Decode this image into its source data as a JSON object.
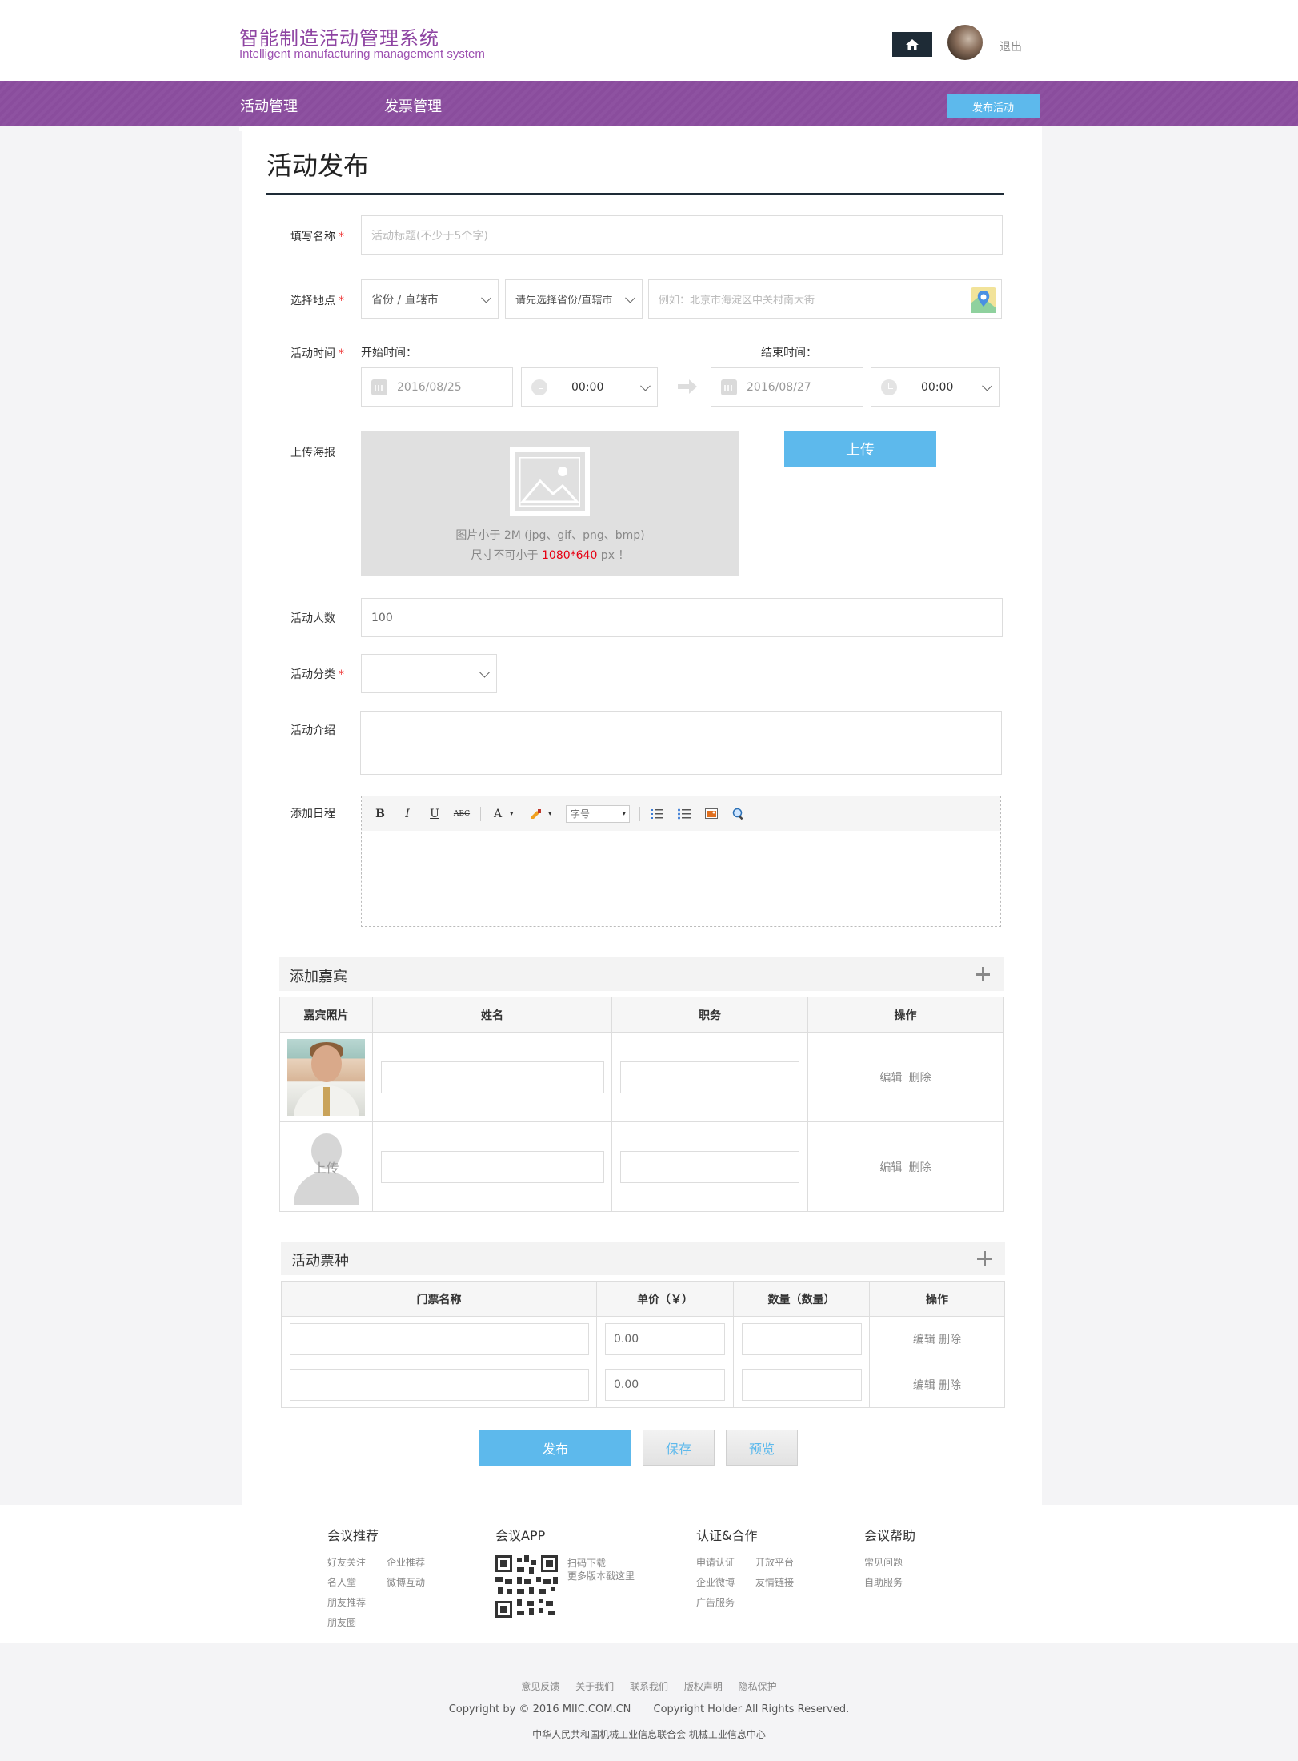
{
  "header": {
    "title_cn": "智能制造活动管理系统",
    "title_en": "Intelligent manufacturing management system",
    "logout": "退出"
  },
  "nav": {
    "items": [
      {
        "label": "活动管理",
        "active": true
      },
      {
        "label": "发票管理",
        "active": false
      }
    ],
    "publish_button": "发布活动"
  },
  "page": {
    "title": "活动发布"
  },
  "form": {
    "name": {
      "label": "填写名称",
      "required": true,
      "placeholder": "活动标题(不少于5个字)"
    },
    "location": {
      "label": "选择地点",
      "required": true,
      "province": "省份 / 直辖市",
      "city": "请先选择省份/直辖市",
      "address_placeholder": "例如：北京市海淀区中关村南大街",
      "map_icon": "map-pin-icon"
    },
    "time": {
      "label": "活动时间",
      "required": true,
      "start_label": "开始时间：",
      "end_label": "结束时间：",
      "start_date": "2016/08/25",
      "start_time": "00:00",
      "end_date": "2016/08/27",
      "end_time": "00:00"
    },
    "poster": {
      "label": "上传海报",
      "hint1": "图片小于 2M (jpg、gif、png、bmp)",
      "hint2_prefix": "尺寸不可小于 ",
      "hint2_size": "1080*640",
      "hint2_suffix": " px ！",
      "upload_button": "上传"
    },
    "count": {
      "label": "活动人数",
      "value": "100"
    },
    "category": {
      "label": "活动分类",
      "required": true,
      "value": ""
    },
    "intro": {
      "label": "活动介绍",
      "value": ""
    },
    "schedule": {
      "label": "添加日程",
      "toolbar": {
        "bold": "B",
        "italic": "I",
        "underline": "U",
        "strike": "ABC",
        "font_color": "A",
        "font_size": "字号"
      }
    }
  },
  "guests": {
    "title": "添加嘉宾",
    "headers": [
      "嘉宾照片",
      "姓名",
      "职务",
      "操作"
    ],
    "rows": [
      {
        "photo": "guest-photo",
        "name": "",
        "position": ""
      },
      {
        "photo": "placeholder",
        "upload_label": "上传",
        "name": "",
        "position": ""
      }
    ],
    "edit": "编辑",
    "delete": "删除"
  },
  "tickets": {
    "title": "活动票种",
    "headers": [
      "门票名称",
      "单价（￥）",
      "数量（数量）",
      "操作"
    ],
    "rows": [
      {
        "name": "",
        "price": "0.00",
        "qty": ""
      },
      {
        "name": "",
        "price": "0.00",
        "qty": ""
      }
    ],
    "edit": "编辑",
    "delete": "删除"
  },
  "actions": {
    "publish": "发布",
    "save": "保存",
    "preview": "预览"
  },
  "footer": {
    "columns": [
      {
        "title": "会议推荐",
        "links": [
          "好友关注",
          "企业推荐",
          "名人堂",
          "微博互动",
          "朋友推荐",
          "",
          "朋友圈",
          ""
        ]
      },
      {
        "title": "会议APP",
        "qr_text_1": "扫码下载",
        "qr_text_2": "更多版本戳这里"
      },
      {
        "title": "认证&合作",
        "links": [
          "申请认证",
          "开放平台",
          "企业微博",
          "友情链接",
          "广告服务",
          ""
        ]
      },
      {
        "title": "会议帮助",
        "links": [
          "常见问题",
          "",
          "自助服务",
          ""
        ]
      }
    ],
    "bottom_links": [
      "意见反馈",
      "关于我们",
      "联系我们",
      "版权声明",
      "隐私保护"
    ],
    "copyright_1": "Copyright by © 2016 MIIC.COM.CN",
    "copyright_2": "Copyright Holder All Rights Reserved.",
    "org": "-  中华人民共和国机械工业信息联合会   机械工业信息中心  -"
  },
  "colors": {
    "brand_purple": "#8e52a1",
    "accent_blue": "#5db9ec",
    "dark": "#1e2b36"
  }
}
